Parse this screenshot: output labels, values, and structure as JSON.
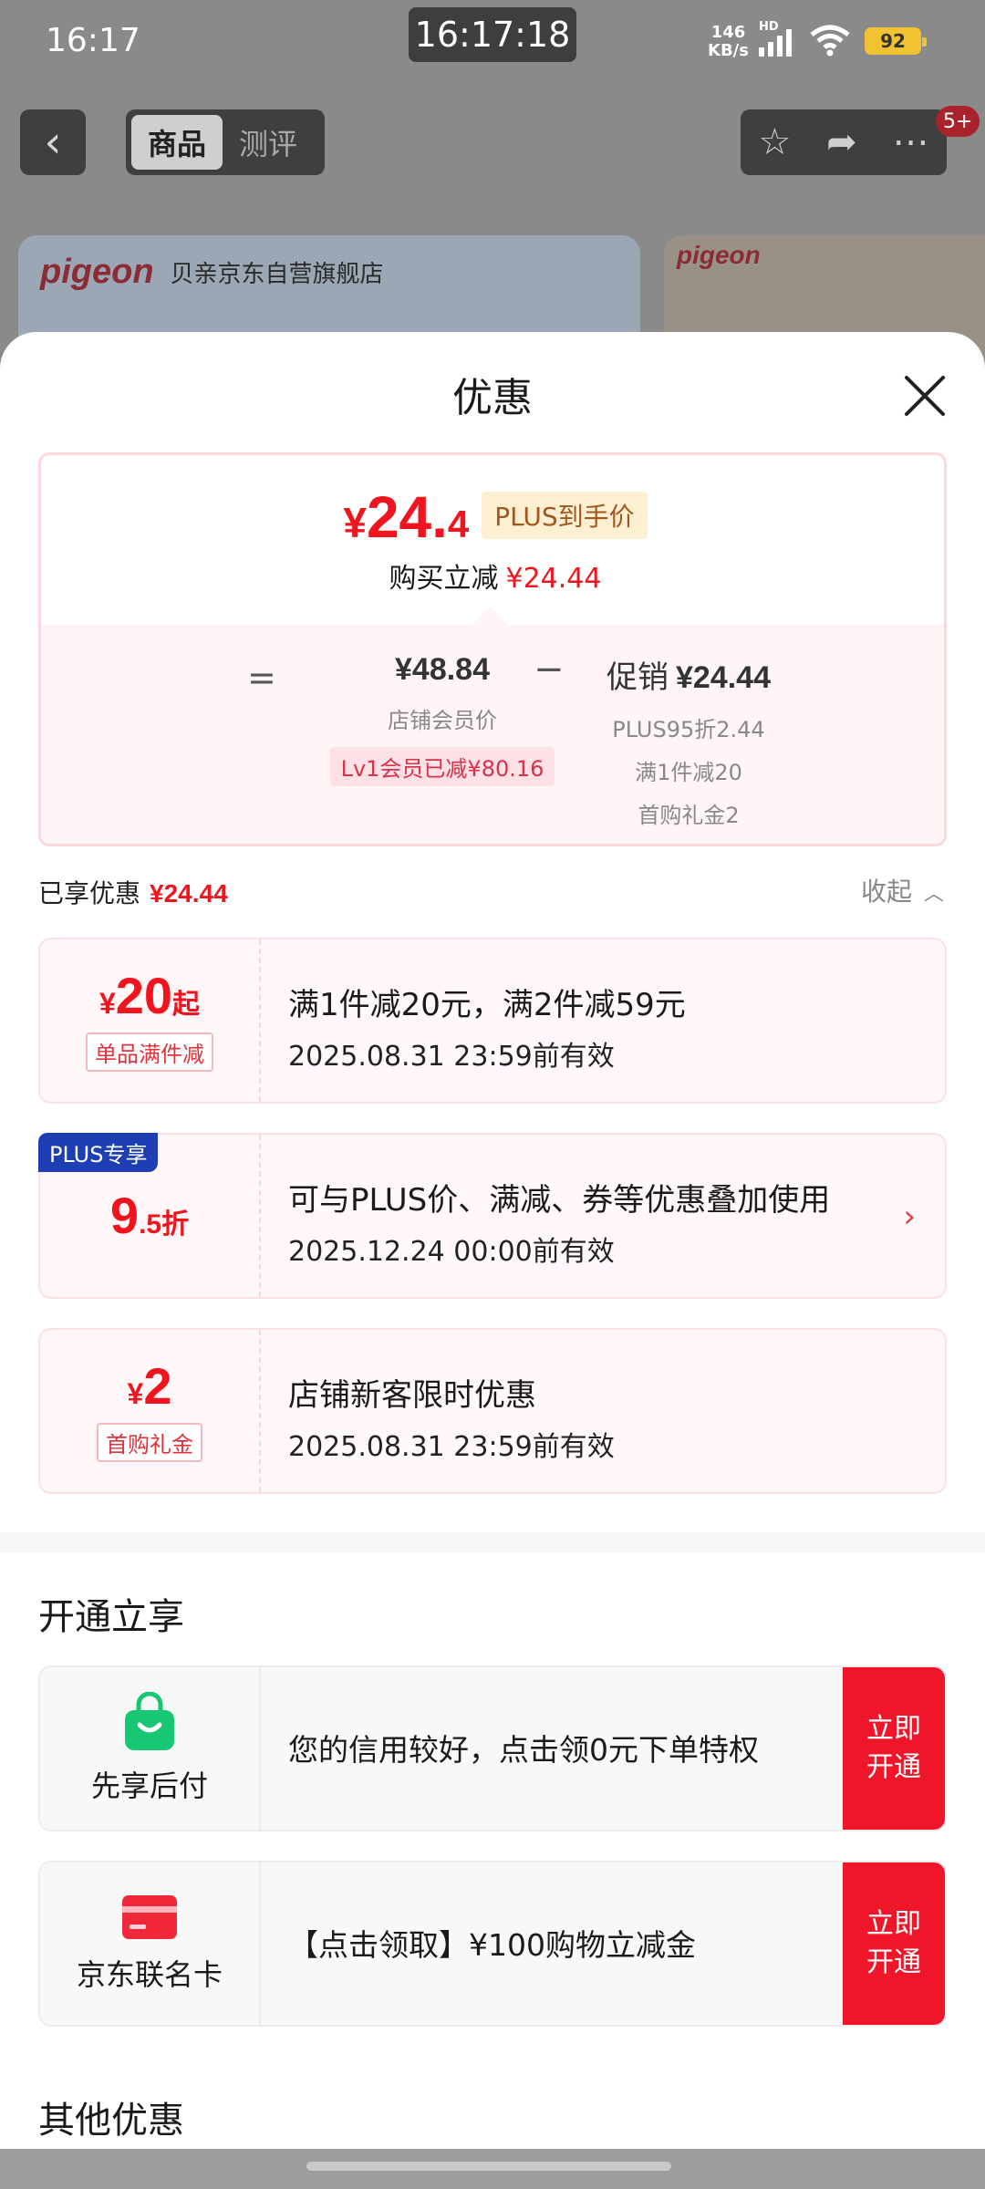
{
  "status_bar": {
    "time": "16:17",
    "clock": "16:17:18",
    "net_speed_value": "146",
    "net_speed_unit": "KB/s",
    "network_label": "HD",
    "battery": "92"
  },
  "top_nav": {
    "tabs": [
      "商品",
      "测评"
    ],
    "active_tab": "商品",
    "badge": "5+"
  },
  "banners": {
    "brand_logo": "pigeon",
    "shop_name": "贝亲京东自营旗舰店"
  },
  "sheet": {
    "title": "优惠",
    "price": {
      "currency": "¥",
      "integer": "24.",
      "decimal": "4",
      "tag": "PLUS到手价",
      "instant_label": "购买立减",
      "instant_amount": "¥24.44"
    },
    "breakdown": {
      "equals": "=",
      "minus": "−",
      "base_amount": "¥48.84",
      "base_label": "店铺会员价",
      "member_note": "Lv1会员已减¥80.16",
      "promo_label": "促销",
      "promo_amount": "¥24.44",
      "promo_lines": [
        "PLUS95折2.44",
        "满1件减20",
        "首购礼金2"
      ]
    },
    "enjoyed": {
      "label": "已享优惠",
      "amount": "¥24.44",
      "collapse_label": "收起"
    },
    "coupons": [
      {
        "amount_prefix": "¥",
        "amount_main": "20",
        "amount_suffix": "起",
        "tag": "单品满件减",
        "title": "满1件减20元，满2件减59元",
        "validity": "2025.08.31 23:59前有效"
      },
      {
        "corner": "PLUS专享",
        "amount_main": "9",
        "amount_suffix": ".5折",
        "title": "可与PLUS价、满减、券等优惠叠加使用",
        "validity": "2025.12.24 00:00前有效"
      },
      {
        "amount_prefix": "¥",
        "amount_main": "2",
        "tag": "首购礼金",
        "title": "店铺新客限时优惠",
        "validity": "2025.08.31 23:59前有效"
      }
    ],
    "open_section_title": "开通立享",
    "open_cards": [
      {
        "name": "先享后付",
        "desc": "您的信用较好，点击领0元下单特权",
        "cta_line1": "立即",
        "cta_line2": "开通"
      },
      {
        "name": "京东联名卡",
        "desc": "【点击领取】¥100购物立减金",
        "cta_line1": "立即",
        "cta_line2": "开通"
      }
    ],
    "other_section_title": "其他优惠"
  },
  "colors": {
    "accent_red": "#f0141e",
    "plus_blue": "#1e3fb4",
    "plus_gold_bg": "#fdf0d2"
  }
}
